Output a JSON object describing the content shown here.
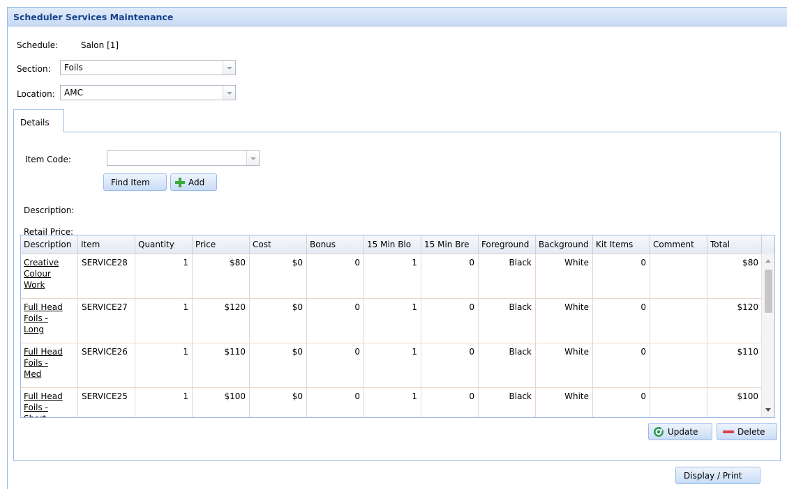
{
  "panel": {
    "title": "Scheduler Services Maintenance"
  },
  "form": {
    "schedule_label": "Schedule:",
    "schedule_value": "Salon [1]",
    "section_label": "Section:",
    "section_value": "Foils",
    "location_label": "Location:",
    "location_value": "AMC"
  },
  "tabs": [
    {
      "label": "Details"
    }
  ],
  "details": {
    "item_code_label": "Item Code:",
    "item_code_value": "",
    "find_item_label": "Find Item",
    "add_label": "Add",
    "description_label": "Description:",
    "retail_price_label": "Retail Price:"
  },
  "grid": {
    "columns": [
      "Description",
      "Item",
      "Quantity",
      "Price",
      "Cost",
      "Bonus",
      "15 Min Blo",
      "15 Min Bre",
      "Foreground",
      "Background",
      "Kit Items",
      "Comment",
      "Total"
    ],
    "rows": [
      {
        "description": "Creative Colour Work",
        "item": "SERVICE28",
        "quantity": "1",
        "price": "$80",
        "cost": "$0",
        "bonus": "0",
        "blocks": "1",
        "breaks": "0",
        "foreground": "Black",
        "background": "White",
        "kit_items": "0",
        "comment": "",
        "total": "$80"
      },
      {
        "description": "Full Head Foils - Long",
        "item": "SERVICE27",
        "quantity": "1",
        "price": "$120",
        "cost": "$0",
        "bonus": "0",
        "blocks": "1",
        "breaks": "0",
        "foreground": "Black",
        "background": "White",
        "kit_items": "0",
        "comment": "",
        "total": "$120"
      },
      {
        "description": "Full Head Foils - Med",
        "item": "SERVICE26",
        "quantity": "1",
        "price": "$110",
        "cost": "$0",
        "bonus": "0",
        "blocks": "1",
        "breaks": "0",
        "foreground": "Black",
        "background": "White",
        "kit_items": "0",
        "comment": "",
        "total": "$110"
      },
      {
        "description": "Full Head Foils - Short",
        "item": "SERVICE25",
        "quantity": "1",
        "price": "$100",
        "cost": "$0",
        "bonus": "0",
        "blocks": "1",
        "breaks": "0",
        "foreground": "Black",
        "background": "White",
        "kit_items": "0",
        "comment": "",
        "total": "$100"
      }
    ]
  },
  "actions": {
    "update_label": "Update",
    "delete_label": "Delete",
    "display_print_label": "Display / Print"
  },
  "icons": {
    "add": "plus-icon",
    "update": "refresh-icon",
    "delete": "minus-icon",
    "combo": "chevron-down-icon"
  },
  "colors": {
    "header_title": "#15428b",
    "border": "#99bbe8",
    "row_line": "#edd5c5",
    "add_green": "#3aa835",
    "delete_red": "#d9414a",
    "update_green": "#2e9a5b"
  }
}
